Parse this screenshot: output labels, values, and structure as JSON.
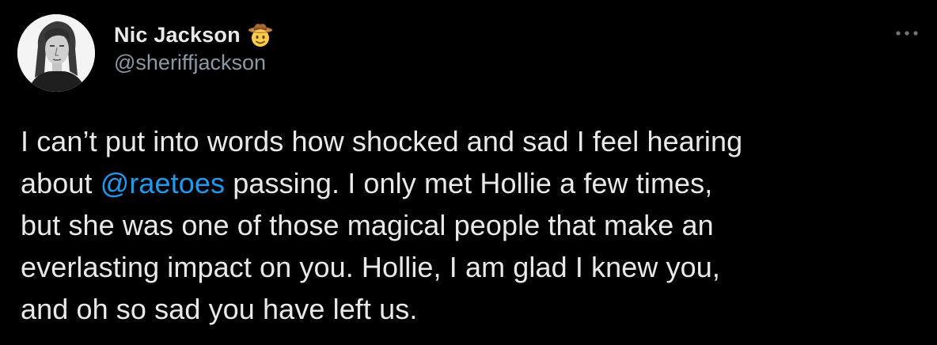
{
  "author": {
    "display_name": "Nic Jackson",
    "handle": "@sheriffjackson",
    "name_emoji": "cowboy-hat-face"
  },
  "more_icon": "ellipsis-icon",
  "tweet": {
    "line1": "I can’t put into words how shocked and sad I feel hearing",
    "line2_before": "about ",
    "line2_mention": "@raetoes",
    "line2_after": " passing. I only met Hollie a few times,",
    "line3": "but she was one of those magical people that make an",
    "line4": "everlasting impact on you. Hollie, I am glad I knew you,",
    "line5": "and oh so sad you have left us."
  },
  "colors": {
    "background": "#000000",
    "text": "#e7e9ea",
    "secondary": "#8b98a5",
    "mention": "#1d9bf0"
  }
}
